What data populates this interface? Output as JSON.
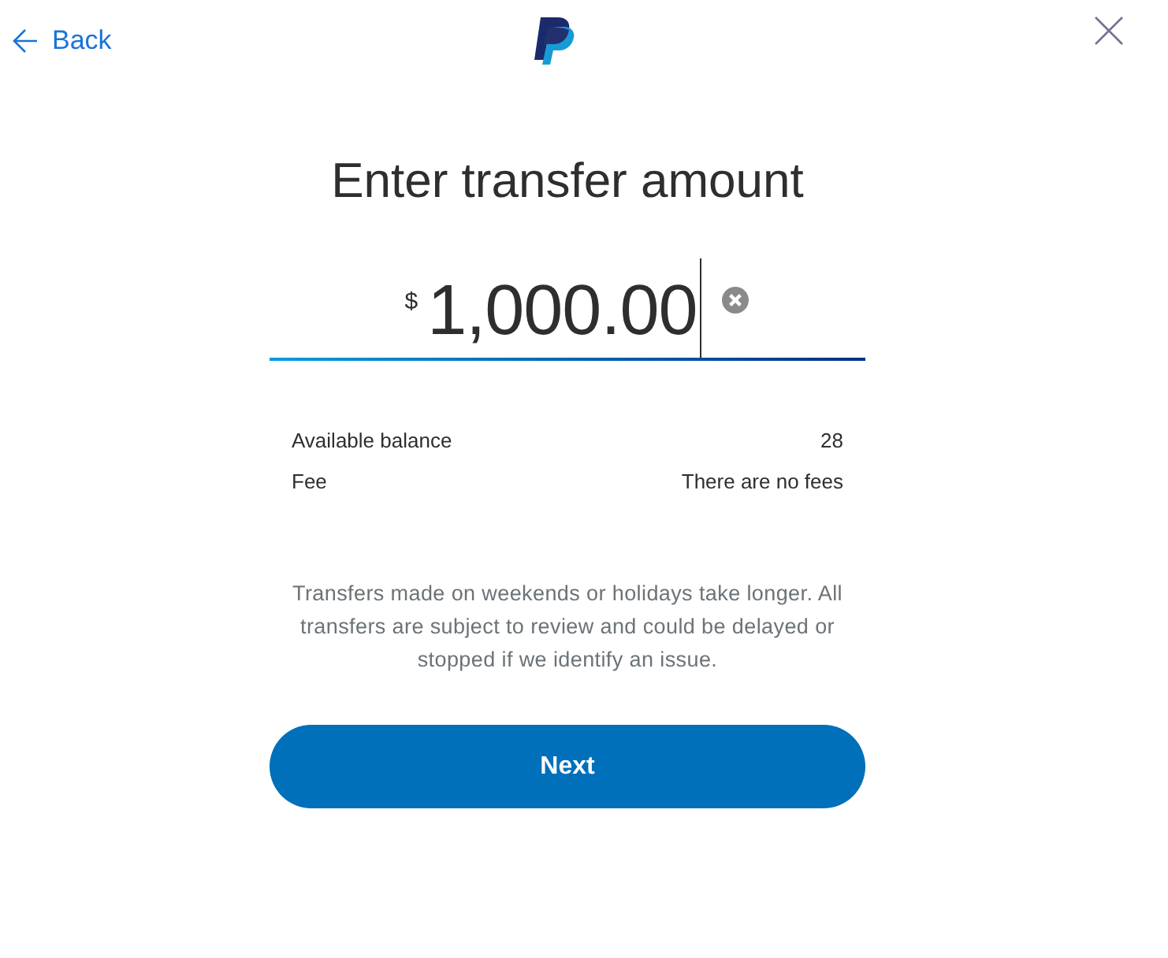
{
  "header": {
    "back_label": "Back"
  },
  "title": "Enter transfer amount",
  "amount": {
    "currency_symbol": "$",
    "value": "1,000.00",
    "focused": true
  },
  "details": [
    {
      "label": "Available balance",
      "value": "28"
    },
    {
      "label": "Fee",
      "value": "There are no fees"
    }
  ],
  "notice": "Transfers made on weekends or holidays take longer. All transfers are subject to review and could be delayed or stopped if we identify an issue.",
  "primary_button": "Next"
}
